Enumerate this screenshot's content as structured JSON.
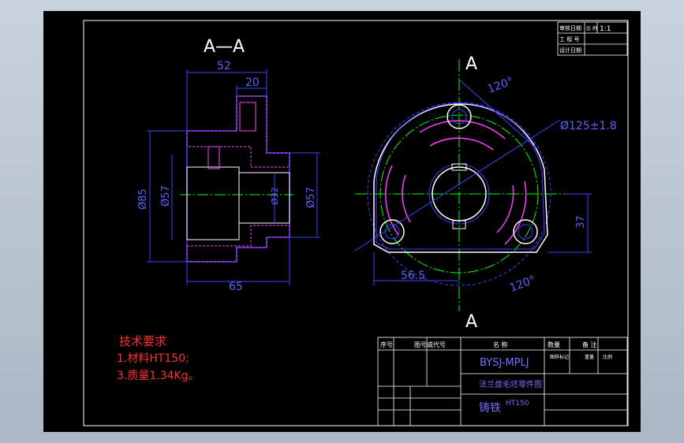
{
  "section": {
    "title": "A—A",
    "dims": {
      "d52": "52",
      "d20": "20",
      "d65": "65",
      "dia85": "Ø85",
      "dia57_left": "Ø57",
      "dia32": "Ø32",
      "dia57_right": "Ø57"
    }
  },
  "front_view": {
    "label_top": "A",
    "label_bottom": "A",
    "angle_top": "120°",
    "angle_bottom": "120°",
    "bolt_circle": "Ø125±1.8",
    "dim_horizontal": "56.5",
    "dim_vertical": "37"
  },
  "notes": {
    "title": "技术要求",
    "line1": "1.材料HT150;",
    "line2": "3.质量1.34Kg。"
  },
  "corner_table": {
    "r1": "审核日期",
    "r1b": "比 例",
    "r1v": "1:1",
    "r2": "工 程 号",
    "r3": "设计日期"
  },
  "title_block": {
    "col_no": "序号",
    "col_code": "图号或代号",
    "col_name": "名 称",
    "col_qty": "数量",
    "col_remark": "备 注",
    "code": "BYSJ-MPLJ",
    "part_name": "法兰盘毛坯零件图",
    "material_label": "铸铁",
    "material": "HT150",
    "small1": "图样标记",
    "small2": "重量",
    "small3": "比例"
  },
  "colors": {
    "paper": "#000000",
    "frame": "#ffffff",
    "outline": "#4040ff",
    "hatch": "#ff40ff",
    "center": "#00ff00",
    "text": "#ffffff",
    "note": "#ff3030",
    "dim_blue": "#6060ff"
  }
}
